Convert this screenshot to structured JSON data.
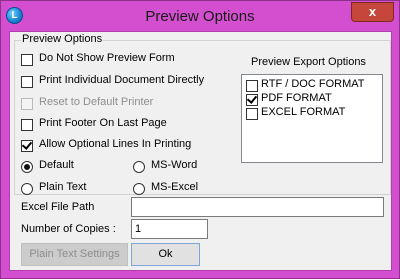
{
  "window": {
    "title": "Preview Options",
    "close_glyph": "x",
    "app_icon_glyph": "L"
  },
  "preview_options": {
    "group_label": "Preview Options",
    "do_not_show_preview_form": {
      "label": "Do Not Show Preview Form",
      "checked": false
    },
    "print_individual_document_directly": {
      "label": "Print Individual Document Directly",
      "checked": false
    },
    "reset_to_default_printer": {
      "label": "Reset to Default Printer",
      "checked": false,
      "enabled": false
    },
    "print_footer_on_last_page": {
      "label": "Print Footer On  Last Page",
      "checked": false
    },
    "allow_optional_lines_in_printing": {
      "label": "Allow Optional Lines In Printing",
      "checked": true
    },
    "format_radios": [
      {
        "label": "Default",
        "selected": true
      },
      {
        "label": "MS-Word",
        "selected": false
      },
      {
        "label": "Plain Text",
        "selected": false
      },
      {
        "label": "MS-Excel",
        "selected": false
      }
    ]
  },
  "export_options": {
    "label": "Preview Export Options",
    "items": [
      {
        "label": "RTF / DOC FORMAT",
        "checked": false
      },
      {
        "label": "PDF FORMAT",
        "checked": true
      },
      {
        "label": "EXCEL FORMAT",
        "checked": false
      }
    ]
  },
  "excel_file_path": {
    "label": "Excel File Path",
    "value": ""
  },
  "number_of_copies": {
    "label": "Number of Copies :",
    "value": "1"
  },
  "buttons": {
    "plain_text_settings": {
      "label": "Plain Text Settings",
      "enabled": false
    },
    "ok": {
      "label": "Ok"
    }
  }
}
